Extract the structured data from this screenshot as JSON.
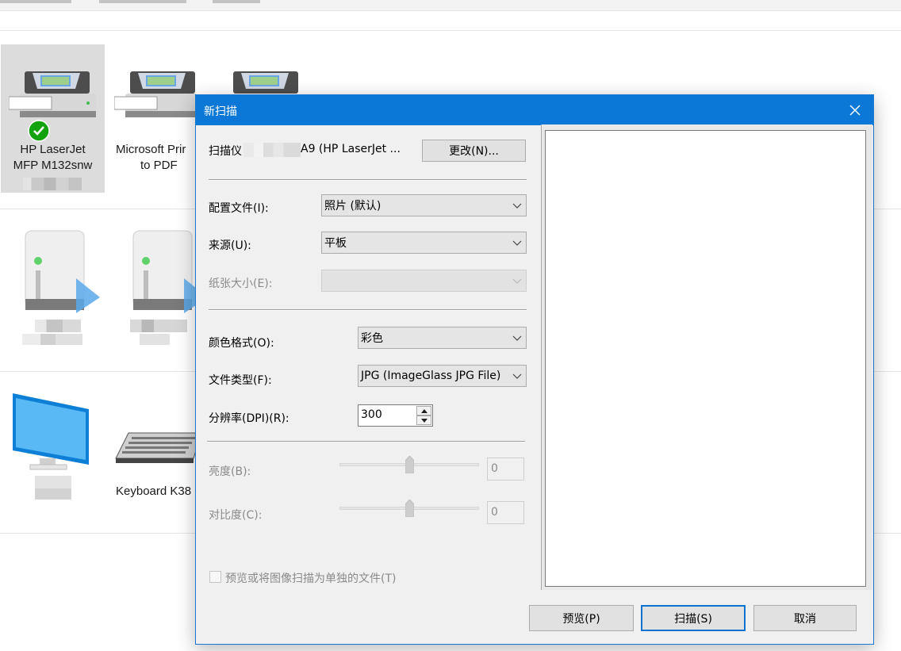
{
  "background": {
    "devices": [
      {
        "name_line1": "HP LaserJet",
        "name_line2": "MFP M132snw",
        "selected": true
      },
      {
        "name_line1": "Microsoft Prir",
        "name_line2": "to PDF"
      },
      {
        "name_line1": "",
        "name_line2": ""
      }
    ],
    "keyboard_label": "Keyboard K38"
  },
  "dialog": {
    "title": "新扫描",
    "scanner_label": "扫描仪",
    "scanner_name": "A9 (HP LaserJet ...",
    "change_button": "更改(N)...",
    "profile_label": "配置文件(I):",
    "profile_value": "照片 (默认)",
    "source_label": "来源(U):",
    "source_value": "平板",
    "paper_size_label": "纸张大小(E):",
    "paper_size_value": "",
    "color_format_label": "颜色格式(O):",
    "color_format_value": "彩色",
    "file_type_label": "文件类型(F):",
    "file_type_value": "JPG (ImageGlass JPG File)",
    "resolution_label": "分辨率(DPI)(R):",
    "resolution_value": "300",
    "brightness_label": "亮度(B):",
    "brightness_value": "0",
    "brightness_level": 0.5,
    "contrast_label": "对比度(C):",
    "contrast_value": "0",
    "contrast_level": 0.5,
    "separate_files_label": "预览或将图像扫描为单独的文件(T)",
    "separate_files_checked": false,
    "preview_button": "预览(P)",
    "scan_button": "扫描(S)",
    "cancel_button": "取消"
  },
  "colors": {
    "titlebar": "#0b78d7",
    "default_button_border": "#0a73cf"
  }
}
